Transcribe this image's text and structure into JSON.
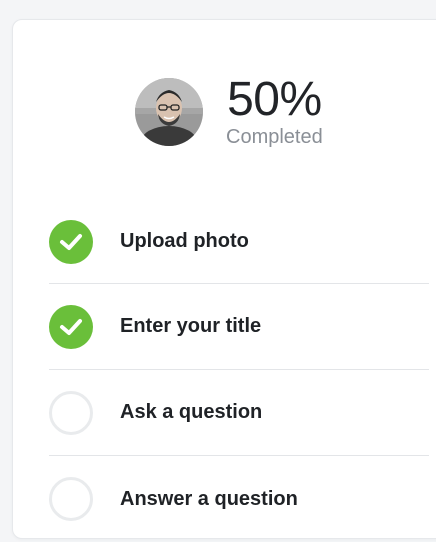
{
  "profile": {
    "avatar_icon": "user-avatar-photo",
    "percent_text": "50%",
    "completed_text": "Completed",
    "progress_fraction": 0.5
  },
  "steps": [
    {
      "label": "Upload photo",
      "done": true,
      "icon": "check-icon"
    },
    {
      "label": "Enter your title",
      "done": true,
      "icon": "check-icon"
    },
    {
      "label": "Ask a question",
      "done": false,
      "icon": "empty-circle-icon"
    },
    {
      "label": "Answer a question",
      "done": false,
      "icon": "empty-circle-icon"
    }
  ],
  "colors": {
    "accent_done": "#6abf3a",
    "todo_ring": "#e9ebed",
    "text_primary": "#1f2226",
    "text_muted": "#8a8f96"
  }
}
